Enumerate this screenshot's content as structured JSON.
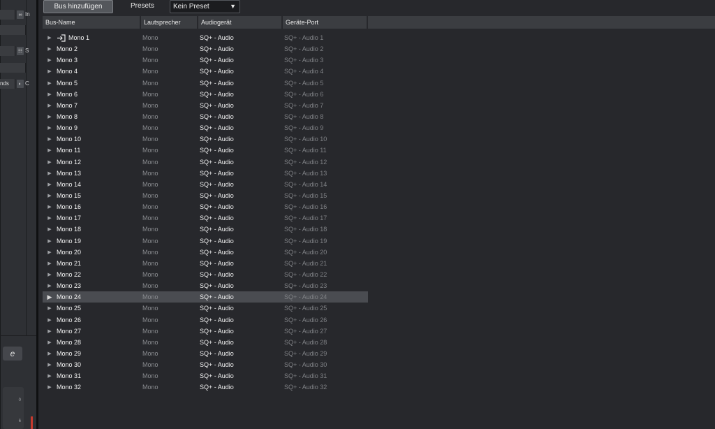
{
  "left_strip": {
    "row1_btn": "∞",
    "row1_tag": "In",
    "row3_btn": "☷",
    "row3_tag": "S",
    "row5_label": "nds",
    "row5_btn": "◐",
    "row5_tag": "C",
    "e_button": "e",
    "scale_top": "0",
    "scale_bottom": "6"
  },
  "toolbar": {
    "add_bus_label": "Bus hinzufügen",
    "presets_label": "Presets",
    "preset_value": "Kein Preset",
    "chevron_icon": "triangle-down",
    "chevron_glyph": "▼"
  },
  "table": {
    "headers": {
      "name": "Bus-Name",
      "speaker": "Lautsprecher",
      "device": "Audiogerät",
      "port": "Geräte-Port"
    },
    "selected_row": "Mono 24",
    "expand_glyph": "▶",
    "rows": [
      {
        "name": "Mono 1",
        "speaker": "Mono",
        "device": "SQ+ - Audio",
        "port": "SQ+ - Audio 1"
      },
      {
        "name": "Mono 2",
        "speaker": "Mono",
        "device": "SQ+ - Audio",
        "port": "SQ+ - Audio 2"
      },
      {
        "name": "Mono 3",
        "speaker": "Mono",
        "device": "SQ+ - Audio",
        "port": "SQ+ - Audio 3"
      },
      {
        "name": "Mono 4",
        "speaker": "Mono",
        "device": "SQ+ - Audio",
        "port": "SQ+ - Audio 4"
      },
      {
        "name": "Mono 5",
        "speaker": "Mono",
        "device": "SQ+ - Audio",
        "port": "SQ+ - Audio 5"
      },
      {
        "name": "Mono 6",
        "speaker": "Mono",
        "device": "SQ+ - Audio",
        "port": "SQ+ - Audio 6"
      },
      {
        "name": "Mono 7",
        "speaker": "Mono",
        "device": "SQ+ - Audio",
        "port": "SQ+ - Audio 7"
      },
      {
        "name": "Mono 8",
        "speaker": "Mono",
        "device": "SQ+ - Audio",
        "port": "SQ+ - Audio 8"
      },
      {
        "name": "Mono 9",
        "speaker": "Mono",
        "device": "SQ+ - Audio",
        "port": "SQ+ - Audio 9"
      },
      {
        "name": "Mono 10",
        "speaker": "Mono",
        "device": "SQ+ - Audio",
        "port": "SQ+ - Audio 10"
      },
      {
        "name": "Mono 11",
        "speaker": "Mono",
        "device": "SQ+ - Audio",
        "port": "SQ+ - Audio 11"
      },
      {
        "name": "Mono 12",
        "speaker": "Mono",
        "device": "SQ+ - Audio",
        "port": "SQ+ - Audio 12"
      },
      {
        "name": "Mono 13",
        "speaker": "Mono",
        "device": "SQ+ - Audio",
        "port": "SQ+ - Audio 13"
      },
      {
        "name": "Mono 14",
        "speaker": "Mono",
        "device": "SQ+ - Audio",
        "port": "SQ+ - Audio 14"
      },
      {
        "name": "Mono 15",
        "speaker": "Mono",
        "device": "SQ+ - Audio",
        "port": "SQ+ - Audio 15"
      },
      {
        "name": "Mono 16",
        "speaker": "Mono",
        "device": "SQ+ - Audio",
        "port": "SQ+ - Audio 16"
      },
      {
        "name": "Mono 17",
        "speaker": "Mono",
        "device": "SQ+ - Audio",
        "port": "SQ+ - Audio 17"
      },
      {
        "name": "Mono 18",
        "speaker": "Mono",
        "device": "SQ+ - Audio",
        "port": "SQ+ - Audio 18"
      },
      {
        "name": "Mono 19",
        "speaker": "Mono",
        "device": "SQ+ - Audio",
        "port": "SQ+ - Audio 19"
      },
      {
        "name": "Mono 20",
        "speaker": "Mono",
        "device": "SQ+ - Audio",
        "port": "SQ+ - Audio 20"
      },
      {
        "name": "Mono 21",
        "speaker": "Mono",
        "device": "SQ+ - Audio",
        "port": "SQ+ - Audio 21"
      },
      {
        "name": "Mono 22",
        "speaker": "Mono",
        "device": "SQ+ - Audio",
        "port": "SQ+ - Audio 22"
      },
      {
        "name": "Mono 23",
        "speaker": "Mono",
        "device": "SQ+ - Audio",
        "port": "SQ+ - Audio 23"
      },
      {
        "name": "Mono 24",
        "speaker": "Mono",
        "device": "SQ+ - Audio",
        "port": "SQ+ - Audio 24"
      },
      {
        "name": "Mono 25",
        "speaker": "Mono",
        "device": "SQ+ - Audio",
        "port": "SQ+ - Audio 25"
      },
      {
        "name": "Mono 26",
        "speaker": "Mono",
        "device": "SQ+ - Audio",
        "port": "SQ+ - Audio 26"
      },
      {
        "name": "Mono 27",
        "speaker": "Mono",
        "device": "SQ+ - Audio",
        "port": "SQ+ - Audio 27"
      },
      {
        "name": "Mono 28",
        "speaker": "Mono",
        "device": "SQ+ - Audio",
        "port": "SQ+ - Audio 28"
      },
      {
        "name": "Mono 29",
        "speaker": "Mono",
        "device": "SQ+ - Audio",
        "port": "SQ+ - Audio 29"
      },
      {
        "name": "Mono 30",
        "speaker": "Mono",
        "device": "SQ+ - Audio",
        "port": "SQ+ - Audio 30"
      },
      {
        "name": "Mono 31",
        "speaker": "Mono",
        "device": "SQ+ - Audio",
        "port": "SQ+ - Audio 31"
      },
      {
        "name": "Mono 32",
        "speaker": "Mono",
        "device": "SQ+ - Audio",
        "port": "SQ+ - Audio 32"
      }
    ]
  },
  "colors": {
    "background": "#27282c",
    "header_bg": "#3b3d41",
    "selected_row_bg": "#4a4c51",
    "meter_red": "#c83a2e"
  }
}
